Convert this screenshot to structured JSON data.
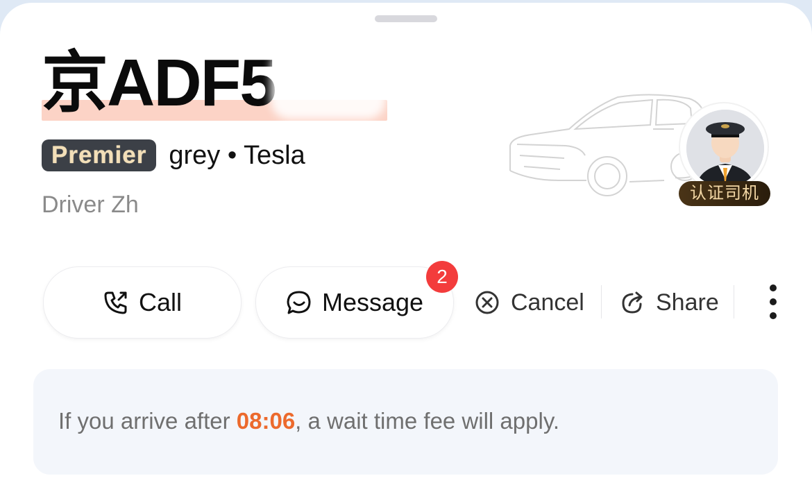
{
  "sheet": {
    "handle": "drag-handle"
  },
  "vehicle": {
    "plate": "京ADF5",
    "tier": "Premier",
    "description": "grey • Tesla"
  },
  "driver": {
    "name": "Driver Zh",
    "certified_label": "认证司机"
  },
  "actions": {
    "call_label": "Call",
    "message_label": "Message",
    "message_unread_count": "2",
    "cancel_label": "Cancel",
    "share_label": "Share"
  },
  "notice": {
    "text_before": "If you arrive after ",
    "time": "08:06",
    "text_after": ", a wait time fee will apply."
  },
  "colors": {
    "accent_orange": "#ec6a2d",
    "badge_red": "#f33c3c",
    "tier_badge_bg": "#3c4047",
    "tier_badge_text": "#f3dfb8"
  }
}
